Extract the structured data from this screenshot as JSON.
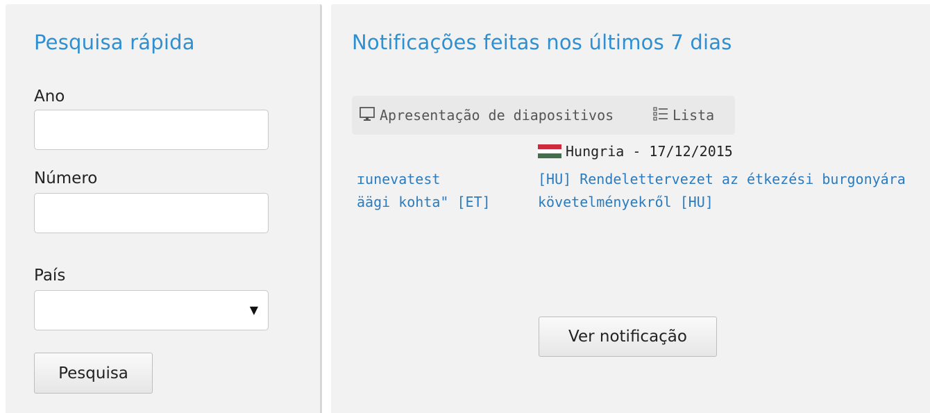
{
  "search": {
    "title": "Pesquisa rápida",
    "year_label": "Ano",
    "year_value": "",
    "number_label": "Número",
    "number_value": "",
    "country_label": "País",
    "country_value": "",
    "submit_label": "Pesquisa"
  },
  "notifications": {
    "title": "Notificações feitas nos últimos 7 dias",
    "view_slideshow_label": "Apresentação de diapositivos",
    "view_list_label": "Lista",
    "previous_item": {
      "line1": "ɪunevatest",
      "line2": "äägi kohta\" [ET]"
    },
    "current_item": {
      "country_date": "Hungria - 17/12/2015",
      "line1": "[HU] Rendelettervezet az étkezési burgonyára",
      "line2": "követelményekről [HU]",
      "flag_colors": [
        "#cd2a3e",
        "#ffffff",
        "#436f4d"
      ]
    },
    "view_button_label": "Ver notificação"
  },
  "icons": {
    "slideshow": "monitor-icon",
    "list": "list-icon",
    "dropdown": "caret-down-icon"
  }
}
